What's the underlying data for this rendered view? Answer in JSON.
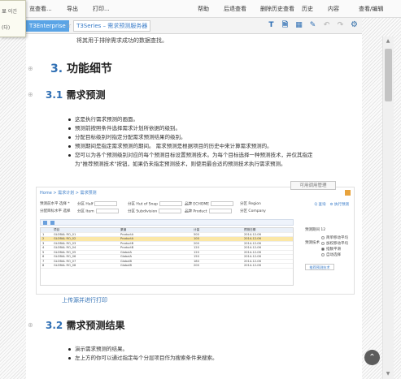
{
  "menu": {
    "items": [
      "览查看...",
      "导出",
      "打印...",
      "帮助",
      "后退查看",
      "删除历史查看",
      "历史",
      "内容",
      "查看/编辑"
    ]
  },
  "left_popup": {
    "line1": "显 이긴",
    "line2": "(다)"
  },
  "tabs": {
    "space_label": "T3Enterprise",
    "page_label": "T3Series – 需求预测服务器",
    "star_icon": "star-icon"
  },
  "toolbar": {
    "tools": [
      {
        "name": "text-style-icon",
        "glyph": "T"
      },
      {
        "name": "document-icon",
        "glyph": "🗎"
      },
      {
        "name": "table-icon",
        "glyph": "▦"
      },
      {
        "name": "edit-icon",
        "glyph": "✎"
      },
      {
        "name": "undo-icon",
        "glyph": "↶"
      },
      {
        "name": "redo-icon",
        "glyph": "↷"
      },
      {
        "name": "gear-icon",
        "glyph": "⚙"
      }
    ]
  },
  "content": {
    "top_text": "将其用于排除需求成功的数据查找。",
    "section3": {
      "number": "3.",
      "title": "功能细节"
    },
    "section31": {
      "number": "3.1",
      "title": "需求预测"
    },
    "bullets31": [
      {
        "text": "这是执行需求预测的画面。"
      },
      {
        "text": "预测前按照条件选择需求计划所依据的级别。"
      },
      {
        "text": "分配目标级别时指定分配需求预测结果的级别。"
      },
      {
        "text": "预测期间是指定需求预测的期间。 需求预测是根据项目的历史中来计算需求预测的。"
      },
      {
        "text": "您可以为各个预测级别对应的每个预测目标设置预测技术。为每个目标选择一种预测技术，并仅其指定",
        "cont": "为\"推荐预测技术\"按钮，如果仍未指定预测技术，则使用最合适的预测技术执行需求预测。"
      }
    ],
    "link_text": "上传源并进行打印",
    "section32": {
      "number": "3.2",
      "title": "需求预测结果"
    },
    "bullets32": [
      {
        "text": "演示需求预测的结果。"
      },
      {
        "text": "左上方的你可以通过指定每个分层项目作为搜索条件来搜索。"
      }
    ]
  },
  "screenshot": {
    "button_label": "可用调用管理",
    "breadcrumb": "Home > 需求计划 > 需求预测",
    "filters_row1": [
      "预测前水平 选择 *",
      "分区 Half",
      "分区 Hut of Snap",
      "品牌 ECHOME",
      "分区 Region"
    ],
    "filters_row2": [
      "分配目标水平 选择",
      "分区 Item",
      "分区 Subdivision",
      "品牌 Product",
      "分区 Company"
    ],
    "actions": [
      "Q 查询",
      "⚙ 执行预测"
    ],
    "table": {
      "headers": [
        "",
        "项目",
        "渠道",
        "计量",
        "预测日期"
      ],
      "rows": [
        [
          "1",
          "GLOBAL RO_01",
          "ProductA",
          "500",
          "2014-12-06"
        ],
        [
          "2",
          "GLOBAL RO_02",
          "ProductA",
          "100",
          "2014-12-06"
        ],
        [
          "3",
          "GLOBAL RO_03",
          "ProductB",
          "200",
          "2014-12-06"
        ],
        [
          "4",
          "GLOBAL RO_04",
          "ProductB",
          "120",
          "2014-12-06"
        ],
        [
          "5",
          "GLOBAL RO_05",
          "GlobalA",
          "120",
          "2014-12-06"
        ],
        [
          "6",
          "GLOBAL RO_06",
          "GlobalA",
          "150",
          "2014-12-06"
        ],
        [
          "7",
          "GLOBAL RO_07",
          "GlobalB",
          "180",
          "2014-12-06"
        ],
        [
          "8",
          "GLOBAL RO_08",
          "GlobalB",
          "200",
          "2014-12-06"
        ]
      ],
      "selected_index": 1
    },
    "right_panel": {
      "input_label": "预测期间 12",
      "label": "预测技术",
      "options": [
        "简单移动平均",
        "加权移动平均",
        "指数平滑",
        "自动选择"
      ],
      "selected_option": 2,
      "apply_label": "推荐预测技术"
    }
  },
  "scroll": {
    "up_icon": "▲",
    "down_icon": "▼",
    "position_fraction": 0.05
  },
  "back_to_top_icon": "⌃"
}
